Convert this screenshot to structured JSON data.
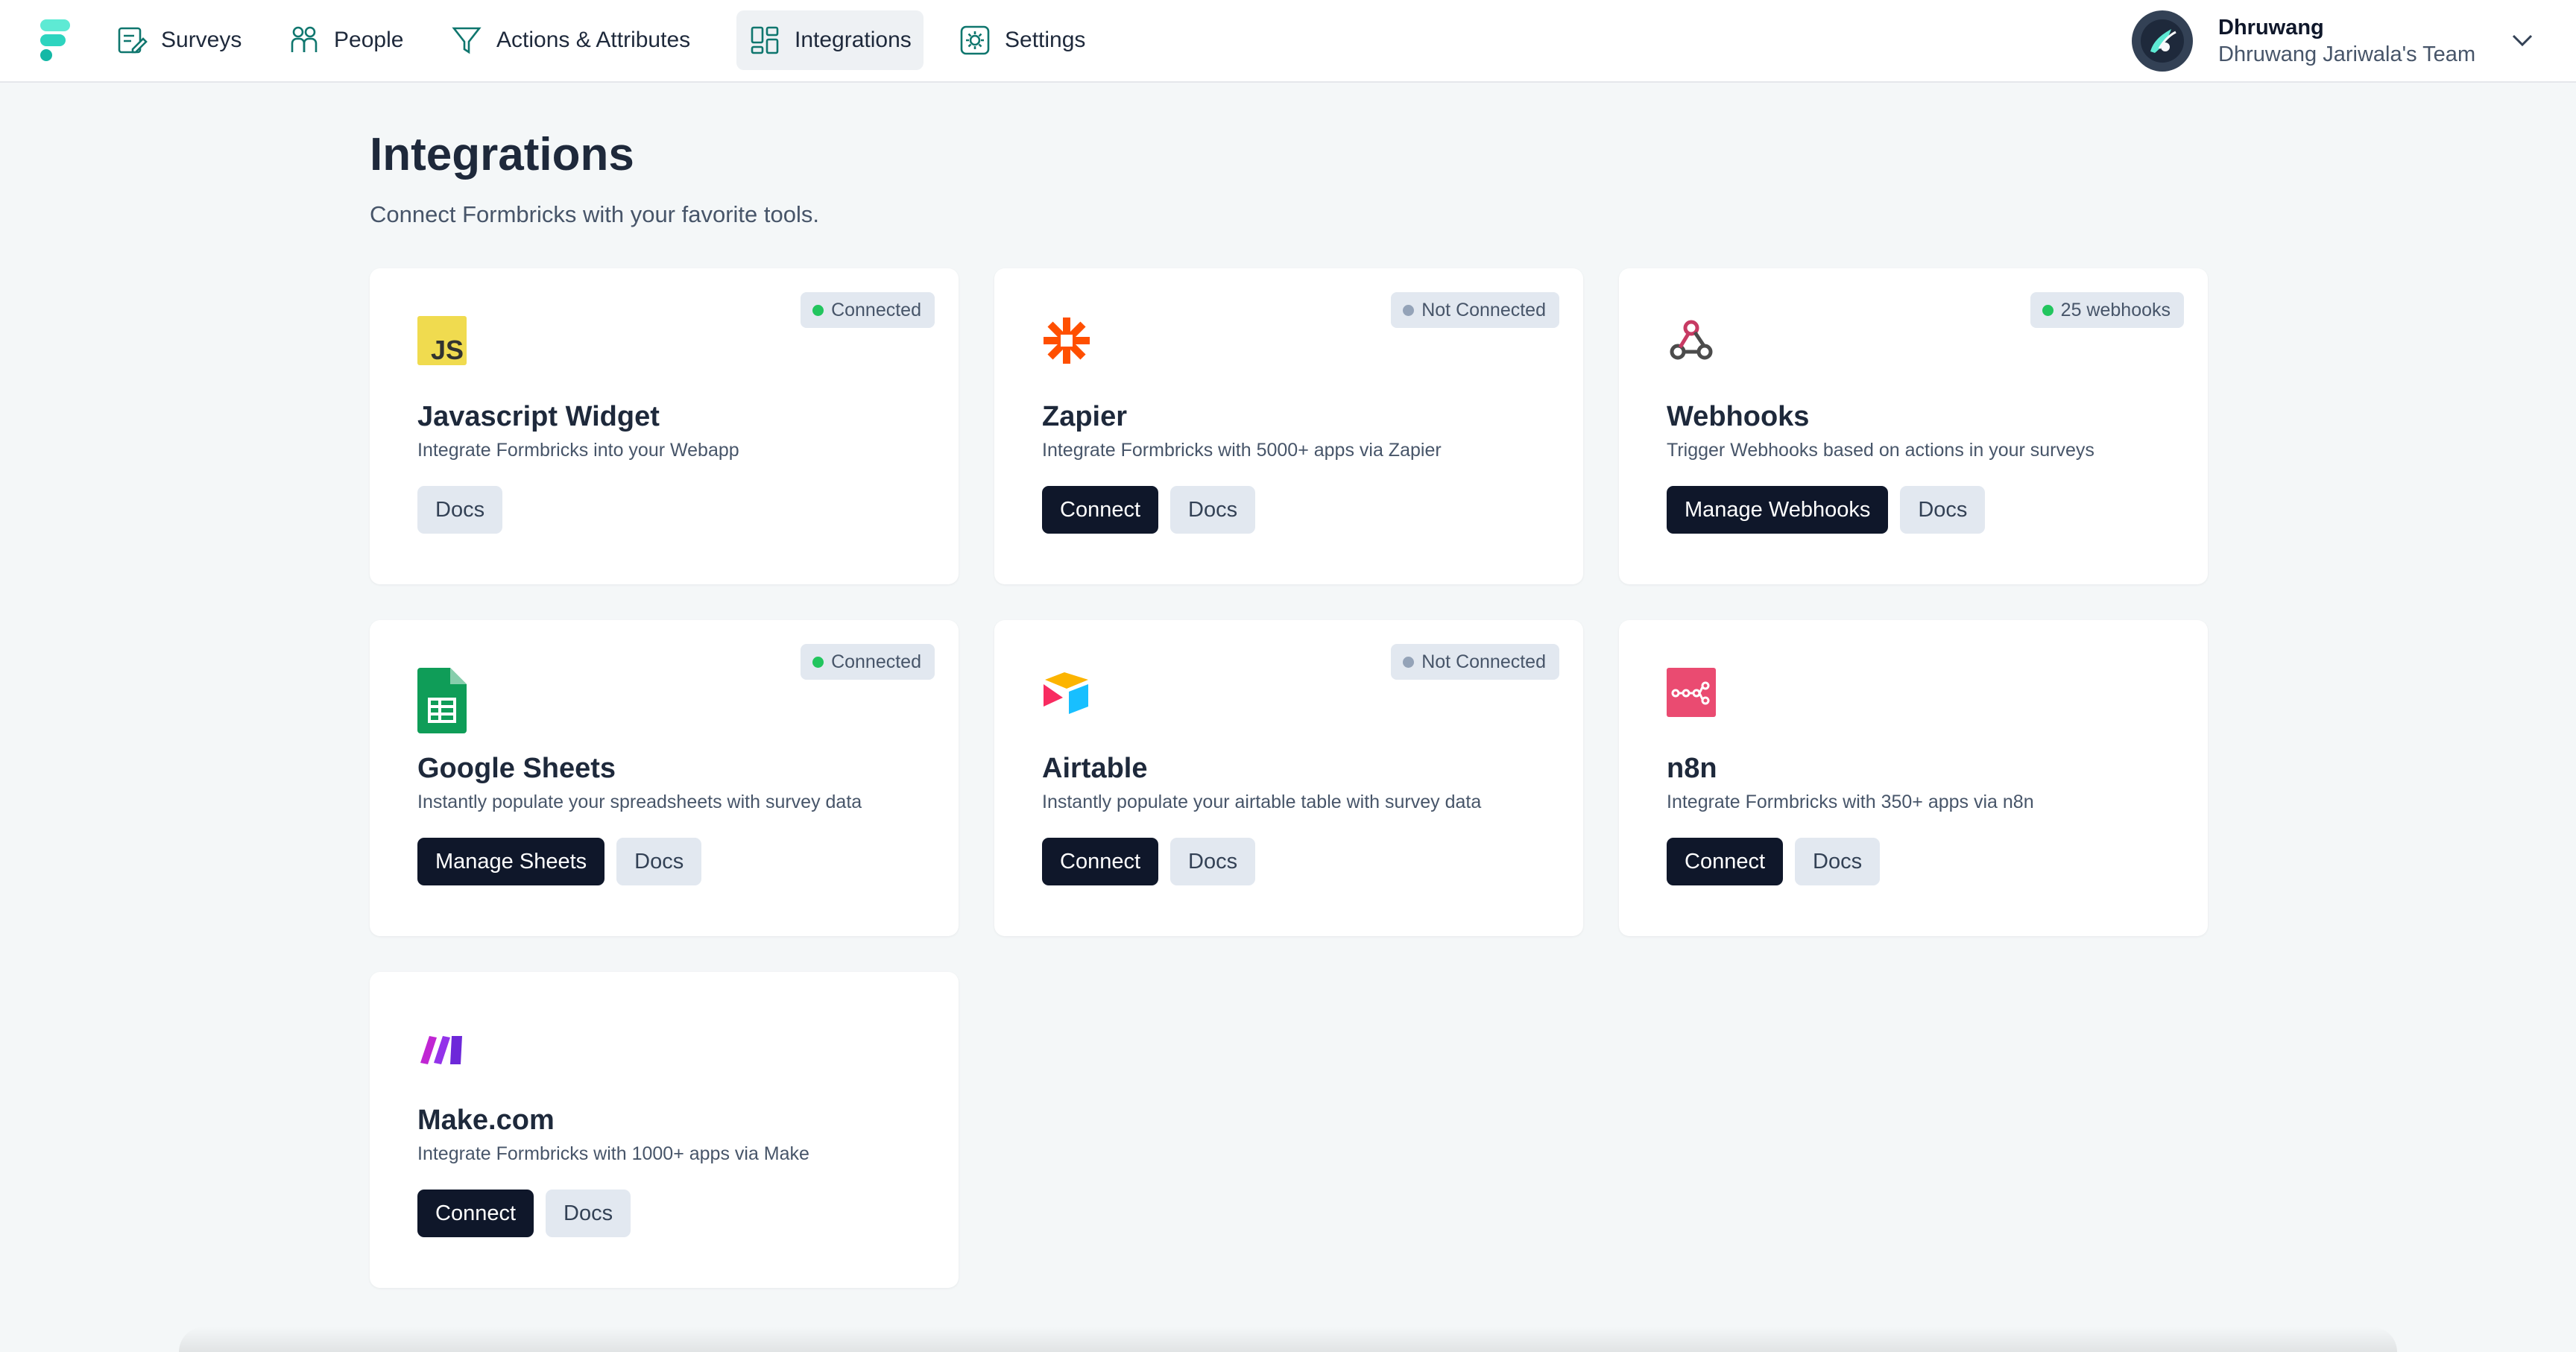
{
  "nav": {
    "items": [
      {
        "label": "Surveys",
        "icon": "survey-edit-icon"
      },
      {
        "label": "People",
        "icon": "people-icon"
      },
      {
        "label": "Actions & Attributes",
        "icon": "filter-funnel-icon"
      },
      {
        "label": "Integrations",
        "icon": "integrations-grid-icon",
        "active": true
      },
      {
        "label": "Settings",
        "icon": "settings-gear-icon"
      }
    ]
  },
  "profile": {
    "name": "Dhruwang",
    "team": "Dhruwang Jariwala's Team"
  },
  "page": {
    "title": "Integrations",
    "subtitle": "Connect Formbricks with your favorite tools."
  },
  "cards": [
    {
      "title": "Javascript Widget",
      "description": "Integrate Formbricks into your Webapp",
      "status": "Connected",
      "status_color": "#22c55e",
      "icon": "javascript-icon",
      "buttons": [
        {
          "label": "Docs",
          "style": "light"
        }
      ]
    },
    {
      "title": "Zapier",
      "description": "Integrate Formbricks with 5000+ apps via Zapier",
      "status": "Not Connected",
      "status_color": "#94a3b8",
      "icon": "zapier-icon",
      "buttons": [
        {
          "label": "Connect",
          "style": "dark"
        },
        {
          "label": "Docs",
          "style": "light"
        }
      ]
    },
    {
      "title": "Webhooks",
      "description": "Trigger Webhooks based on actions in your surveys",
      "status": "25 webhooks",
      "status_color": "#22c55e",
      "icon": "webhook-icon",
      "buttons": [
        {
          "label": "Manage Webhooks",
          "style": "dark"
        },
        {
          "label": "Docs",
          "style": "light"
        }
      ]
    },
    {
      "title": "Google Sheets",
      "description": "Instantly populate your spreadsheets with survey data",
      "status": "Connected",
      "status_color": "#22c55e",
      "icon": "google-sheets-icon",
      "buttons": [
        {
          "label": "Manage Sheets",
          "style": "dark"
        },
        {
          "label": "Docs",
          "style": "light"
        }
      ]
    },
    {
      "title": "Airtable",
      "description": "Instantly populate your airtable table with survey data",
      "status": "Not Connected",
      "status_color": "#94a3b8",
      "icon": "airtable-icon",
      "buttons": [
        {
          "label": "Connect",
          "style": "dark"
        },
        {
          "label": "Docs",
          "style": "light"
        }
      ]
    },
    {
      "title": "n8n",
      "description": "Integrate Formbricks with 350+ apps via n8n",
      "icon": "n8n-icon",
      "buttons": [
        {
          "label": "Connect",
          "style": "dark"
        },
        {
          "label": "Docs",
          "style": "light"
        }
      ]
    },
    {
      "title": "Make.com",
      "description": "Integrate Formbricks with 1000+ apps via Make",
      "icon": "make-icon",
      "buttons": [
        {
          "label": "Connect",
          "style": "dark"
        },
        {
          "label": "Docs",
          "style": "light"
        }
      ]
    }
  ],
  "colors": {
    "brand": "#2dd4bf",
    "primary_button": "#0f172a",
    "secondary_button": "#e2e8f0",
    "background": "#f4f7f8"
  }
}
